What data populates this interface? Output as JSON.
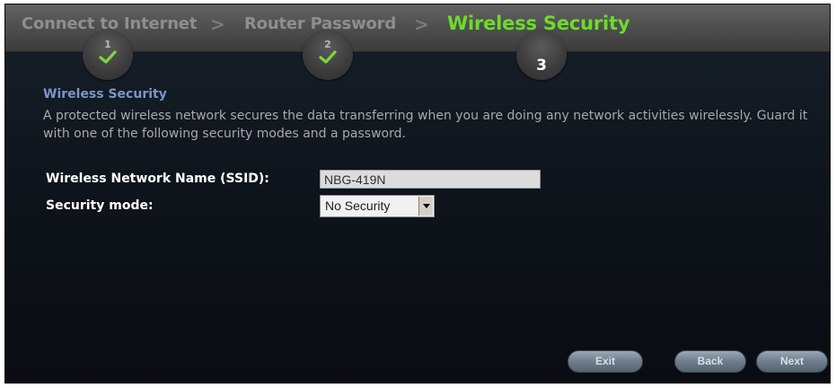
{
  "steps": [
    {
      "label": "Connect to Internet",
      "number": "1",
      "status": "done"
    },
    {
      "label": "Router Password",
      "number": "2",
      "status": "done"
    },
    {
      "label": "Wireless Security",
      "number": "3",
      "status": "active"
    }
  ],
  "separator": ">",
  "section": {
    "title": "Wireless Security",
    "description": "A protected wireless network secures the data transferring when you are doing any network activities wirelessly. Guard it with one of the following security modes and a password."
  },
  "form": {
    "ssid_label": "Wireless Network Name (SSID):",
    "ssid_value": "NBG-419N",
    "security_label": "Security mode:",
    "security_value": "No Security"
  },
  "buttons": {
    "exit": "Exit",
    "back": "Back",
    "next": "Next"
  },
  "colors": {
    "active_step": "#6ddb2a",
    "done_check": "#7ed63a",
    "section_title": "#7a96c8"
  },
  "icons": {
    "done": "checkmark-icon",
    "dropdown": "chevron-down-icon"
  }
}
